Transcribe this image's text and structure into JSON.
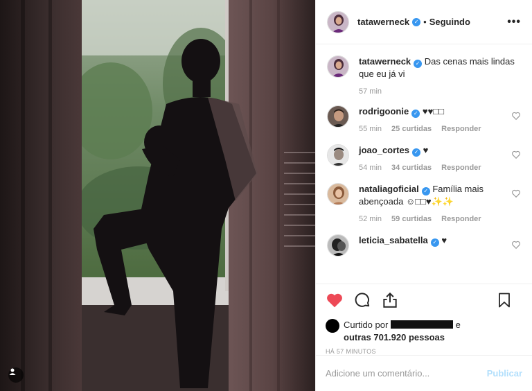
{
  "post": {
    "author": "tatawerneck",
    "follow_status": "Seguindo",
    "separator": "•",
    "more_label": "•••",
    "verified_glyph": "✓"
  },
  "caption": {
    "user": "tatawerneck",
    "text": "Das cenas mais lindas que eu já vi",
    "age": "57 min"
  },
  "comments": [
    {
      "user": "rodrigoonie",
      "text": "♥♥□□",
      "age": "55 min",
      "likes": "25 curtidas",
      "reply": "Responder"
    },
    {
      "user": "joao_cortes",
      "text": "♥",
      "age": "54 min",
      "likes": "34 curtidas",
      "reply": "Responder"
    },
    {
      "user": "nataliagoficial",
      "text": "Família mais abençoada ☺□□♥✨✨",
      "age": "52 min",
      "likes": "59 curtidas",
      "reply": "Responder"
    },
    {
      "user": "leticia_sabatella",
      "text": "♥",
      "age": "",
      "likes": "",
      "reply": ""
    }
  ],
  "likes": {
    "prefix": "Curtido por",
    "conj": "e",
    "others": "outras 701.920 pessoas"
  },
  "timestamp": "Há 57 minutos",
  "add_comment": {
    "placeholder": "Adicione um comentário...",
    "publish_label": "Publicar"
  },
  "colors": {
    "like_red": "#ed4956",
    "verified_blue": "#3897f0",
    "publish_disabled": "#b2dffc"
  },
  "icons": [
    "heart-filled-icon",
    "comment-icon",
    "share-icon",
    "bookmark-icon",
    "user-tag-icon",
    "verified-badge-icon",
    "heart-outline-icon",
    "more-icon"
  ]
}
